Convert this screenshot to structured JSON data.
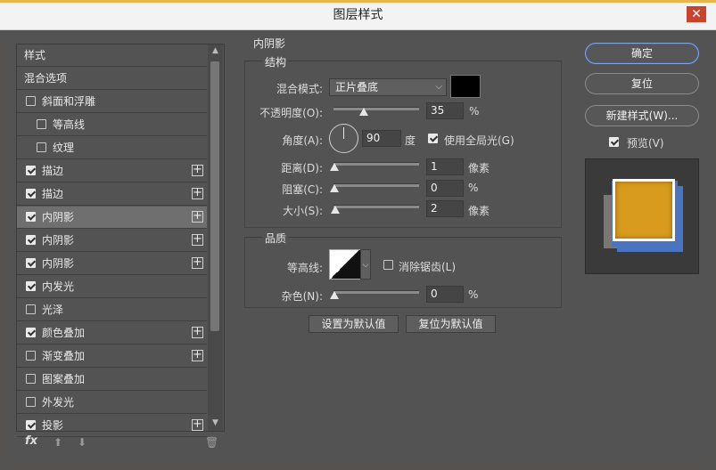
{
  "window": {
    "title": "图层样式",
    "close_glyph": "✕"
  },
  "style_list": {
    "items": [
      {
        "label": "样式",
        "checkbox": false,
        "checked": false,
        "plus": false,
        "selected": false,
        "indent": 0
      },
      {
        "label": "混合选项",
        "checkbox": false,
        "checked": false,
        "plus": false,
        "selected": false,
        "indent": 0
      },
      {
        "label": "斜面和浮雕",
        "checkbox": true,
        "checked": false,
        "plus": false,
        "selected": false,
        "indent": 0
      },
      {
        "label": "等高线",
        "checkbox": true,
        "checked": false,
        "plus": false,
        "selected": false,
        "indent": 1
      },
      {
        "label": "纹理",
        "checkbox": true,
        "checked": false,
        "plus": false,
        "selected": false,
        "indent": 1
      },
      {
        "label": "描边",
        "checkbox": true,
        "checked": true,
        "plus": true,
        "selected": false,
        "indent": 0
      },
      {
        "label": "描边",
        "checkbox": true,
        "checked": true,
        "plus": true,
        "selected": false,
        "indent": 0
      },
      {
        "label": "内阴影",
        "checkbox": true,
        "checked": true,
        "plus": true,
        "selected": true,
        "indent": 0
      },
      {
        "label": "内阴影",
        "checkbox": true,
        "checked": true,
        "plus": true,
        "selected": false,
        "indent": 0
      },
      {
        "label": "内阴影",
        "checkbox": true,
        "checked": true,
        "plus": true,
        "selected": false,
        "indent": 0
      },
      {
        "label": "内发光",
        "checkbox": true,
        "checked": true,
        "plus": false,
        "selected": false,
        "indent": 0
      },
      {
        "label": "光泽",
        "checkbox": true,
        "checked": false,
        "plus": false,
        "selected": false,
        "indent": 0
      },
      {
        "label": "颜色叠加",
        "checkbox": true,
        "checked": true,
        "plus": true,
        "selected": false,
        "indent": 0
      },
      {
        "label": "渐变叠加",
        "checkbox": true,
        "checked": false,
        "plus": true,
        "selected": false,
        "indent": 0
      },
      {
        "label": "图案叠加",
        "checkbox": true,
        "checked": false,
        "plus": false,
        "selected": false,
        "indent": 0
      },
      {
        "label": "外发光",
        "checkbox": true,
        "checked": false,
        "plus": false,
        "selected": false,
        "indent": 0
      },
      {
        "label": "投影",
        "checkbox": true,
        "checked": true,
        "plus": true,
        "selected": false,
        "indent": 0
      }
    ],
    "footer": {
      "fx_label": "fx",
      "up_glyph": "⬆",
      "down_glyph": "⬇",
      "trash_glyph": "🗑"
    }
  },
  "inner_shadow": {
    "section_title": "内阴影",
    "structure": {
      "title": "结构",
      "blend_mode_label": "混合模式:",
      "blend_mode_value": "正片叠底",
      "shadow_color": "#000000",
      "opacity_label": "不透明度(O):",
      "opacity_value": "35",
      "opacity_unit": "%",
      "opacity_fraction": 0.35,
      "angle_label": "角度(A):",
      "angle_value": "90",
      "angle_unit": "度",
      "global_light_label": "使用全局光(G)",
      "global_light_checked": true,
      "distance_label": "距离(D):",
      "distance_value": "1",
      "distance_unit": "像素",
      "choke_label": "阻塞(C):",
      "choke_value": "0",
      "choke_unit": "%",
      "size_label": "大小(S):",
      "size_value": "2",
      "size_unit": "像素"
    },
    "quality": {
      "title": "品质",
      "contour_label": "等高线:",
      "antialias_label": "消除锯齿(L)",
      "antialias_checked": false,
      "noise_label": "杂色(N):",
      "noise_value": "0",
      "noise_unit": "%"
    },
    "set_default_label": "设置为默认值",
    "reset_default_label": "复位为默认值"
  },
  "actions": {
    "ok_label": "确定",
    "reset_label": "复位",
    "new_style_label": "新建样式(W)...",
    "preview_label": "预览(V)",
    "preview_checked": true
  },
  "preview_colors": {
    "fill": "#d89b1e",
    "stroke_white": "#ffffff",
    "blue": "#4a74c0",
    "gray": "#7c7670"
  }
}
